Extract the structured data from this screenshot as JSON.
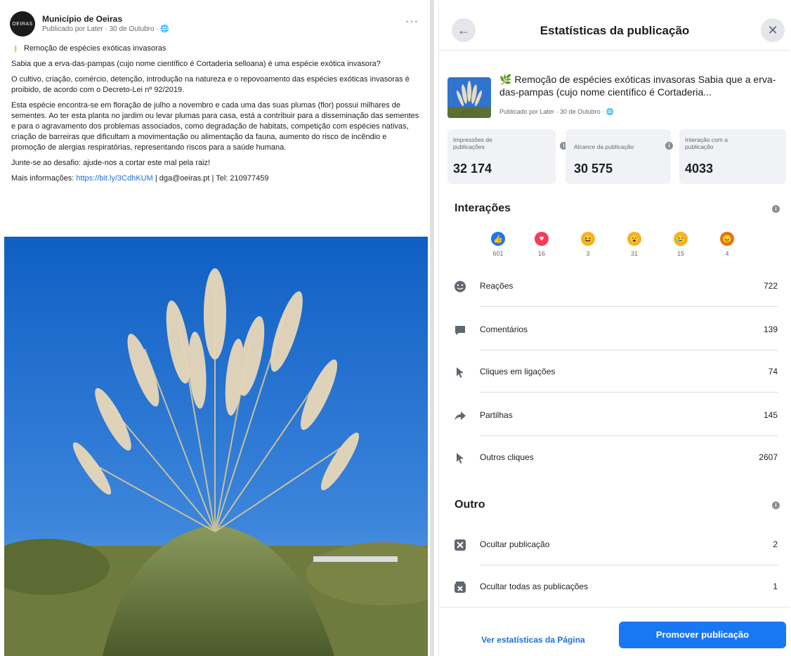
{
  "post": {
    "avatar_text": "OEIRAS",
    "page_name": "Município de Oeiras",
    "meta": "Publicado por Later · 30 de Outubro · 🌐",
    "title": "Remoção de espécies exóticas invasoras",
    "paragraph1": "Sabia que a erva-das-pampas (cujo nome científico é Cortaderia selloana) é uma espécie exótica invasora?",
    "paragraph2": "O cultivo, criação, comércio, detenção, introdução na natureza e o repovoamento das espécies exóticas invasoras é proibido, de acordo com o Decreto-Lei nº 92/2019.",
    "paragraph3": "Esta espécie encontra-se em floração de julho a novembro e cada uma das suas plumas (flor) possui milhares de sementes. Ao ter esta planta no jardim ou levar plumas para casa, está a contribuir para a disseminação das sementes e para o agravamento dos problemas associados, como degradação de habitats, competição com espécies nativas, criação de barreiras que dificultam a movimentação ou alimentação da fauna, aumento do risco de incêndio e promoção de alergias respiratórias, representando riscos para a saúde humana.",
    "paragraph4": "Junte-se ao desafio: ajude-nos a cortar este mal pela raiz!",
    "info_prefix": "Mais informações:",
    "info_link": "https://bit.ly/3CdhKUM",
    "info_suffix": "| dga@oeiras.pt | Tel: 210977459"
  },
  "modal": {
    "title": "Estatísticas da publicação",
    "preview_text": "Remoção de espécies exóticas invasoras Sabia que a erva-das-pampas (cujo nome científico é Cortaderia...",
    "preview_meta": "Publicado por Later · 30 de Outubro · 🌐",
    "stats": [
      {
        "label": "Impressões de publicações",
        "value": "32 174"
      },
      {
        "label": "Alcance da publicação",
        "value": "30 575"
      },
      {
        "label": "Interação com a publicação",
        "value": "4033"
      }
    ],
    "interactions_title": "Interações",
    "reactions": [
      {
        "icon": "like-icon",
        "count": "601",
        "color": "#1877f2"
      },
      {
        "icon": "love-icon",
        "count": "16",
        "color": "#f33e58"
      },
      {
        "icon": "haha-icon",
        "count": "3",
        "color": "#f7b125"
      },
      {
        "icon": "wow-icon",
        "count": "31",
        "color": "#f7b125"
      },
      {
        "icon": "sad-icon",
        "count": "15",
        "color": "#f7b125"
      },
      {
        "icon": "angry-icon",
        "count": "4",
        "color": "#e9710f"
      }
    ],
    "rows": [
      {
        "label": "Reações",
        "value": "722"
      },
      {
        "label": "Comentários",
        "value": "139"
      },
      {
        "label": "Cliques em ligações",
        "value": "74"
      },
      {
        "label": "Partilhas",
        "value": "145"
      },
      {
        "label": "Outros cliques",
        "value": "2607"
      }
    ],
    "other_title": "Outro",
    "other_rows": [
      {
        "label": "Ocultar publicação",
        "value": "2"
      },
      {
        "label": "Ocultar todas as publicações",
        "value": "1"
      }
    ],
    "footer_link": "Ver estatísticas da Página",
    "footer_button": "Promover publicação"
  }
}
